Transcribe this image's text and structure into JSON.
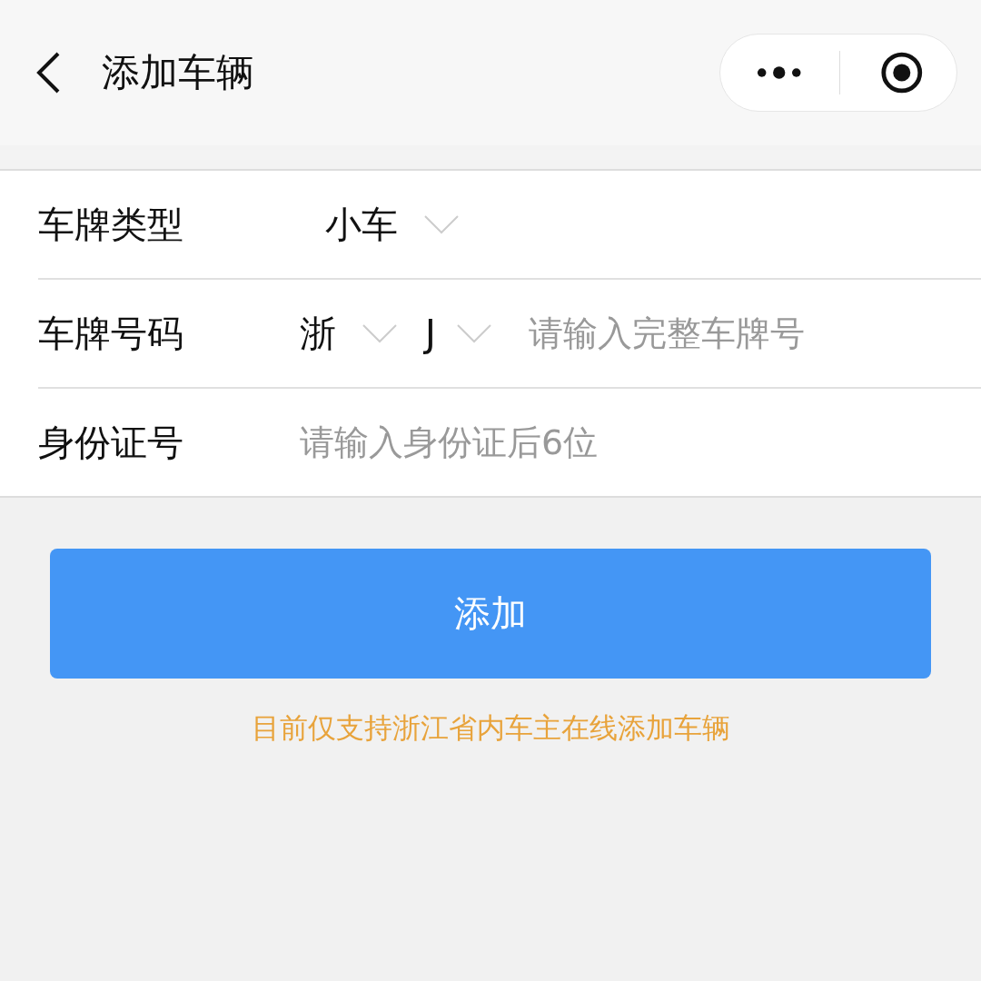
{
  "header": {
    "title": "添加车辆"
  },
  "form": {
    "rows": [
      {
        "kind": "select",
        "label": "车牌类型",
        "value": "小车"
      },
      {
        "kind": "plate",
        "label": "车牌号码",
        "province": "浙",
        "city": "J",
        "placeholder": "请输入完整车牌号"
      },
      {
        "kind": "input",
        "label": "身份证号",
        "placeholder": "请输入身份证后6位"
      }
    ]
  },
  "submit": "添加",
  "note": "目前仅支持浙江省内车主在线添加车辆"
}
